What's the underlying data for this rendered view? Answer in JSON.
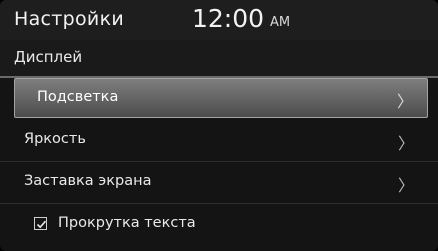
{
  "header": {
    "title": "Настройки",
    "time": "12:00",
    "ampm": "AM"
  },
  "section": {
    "title": "Дисплей"
  },
  "menu": {
    "items": [
      {
        "label": "Подсветка",
        "selected": true,
        "icon": "chevron-right-icon"
      },
      {
        "label": "Яркость",
        "selected": false,
        "icon": "chevron-right-icon"
      },
      {
        "label": "Заставка экрана",
        "selected": false,
        "icon": "chevron-right-icon"
      }
    ],
    "checkbox_item": {
      "label": "Прокрутка текста",
      "checked": true,
      "icon": "checkbox-checked-icon"
    }
  },
  "colors": {
    "background": "#141414",
    "selected_row": "#6a6a6a",
    "text": "#e9e9e9"
  }
}
